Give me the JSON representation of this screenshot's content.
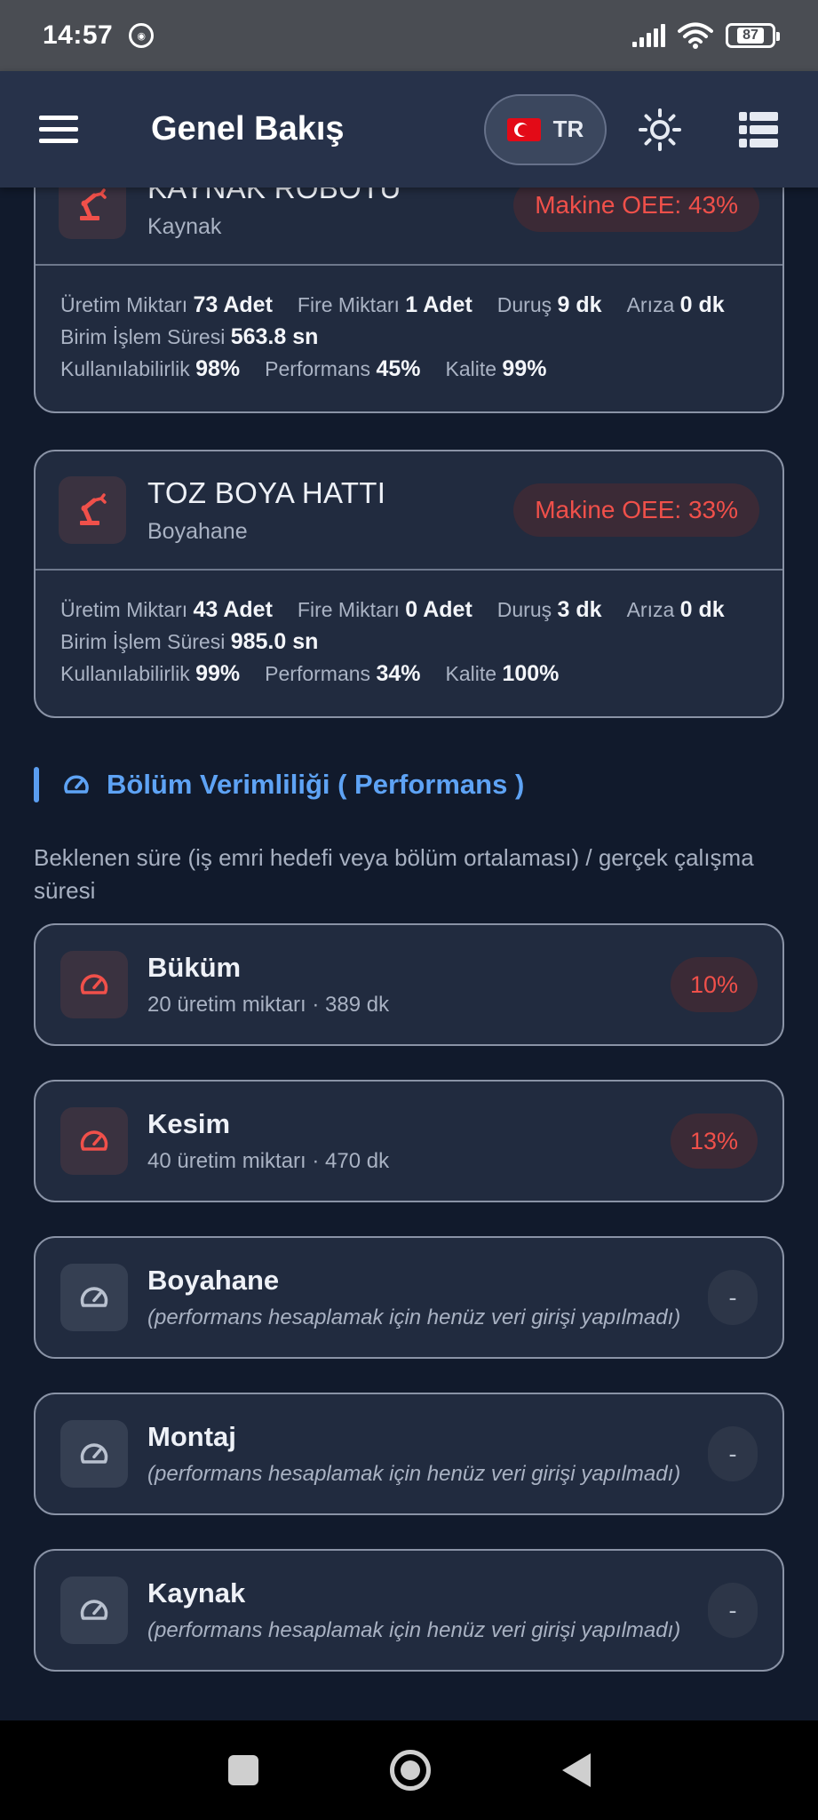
{
  "status_bar": {
    "time": "14:57",
    "battery": "87"
  },
  "header": {
    "title": "Genel Bakış",
    "language": "TR"
  },
  "machines": [
    {
      "name": "KAYNAK ROBOTU",
      "department": "Kaynak",
      "oee": "Makine OEE: 43%",
      "uretim_label": "Üretim Miktarı",
      "uretim": "73 Adet",
      "fire_label": "Fire Miktarı",
      "fire": "1 Adet",
      "durus_label": "Duruş",
      "durus": "9 dk",
      "ariza_label": "Arıza",
      "ariza": "0 dk",
      "sure_label": "Birim İşlem Süresi",
      "sure": "563.8 sn",
      "kull_label": "Kullanılabilirlik",
      "kull": "98%",
      "perf_label": "Performans",
      "perf": "45%",
      "kalite_label": "Kalite",
      "kalite": "99%"
    },
    {
      "name": "TOZ BOYA HATTI",
      "department": "Boyahane",
      "oee": "Makine OEE: 33%",
      "uretim_label": "Üretim Miktarı",
      "uretim": "43 Adet",
      "fire_label": "Fire Miktarı",
      "fire": "0 Adet",
      "durus_label": "Duruş",
      "durus": "3 dk",
      "ariza_label": "Arıza",
      "ariza": "0 dk",
      "sure_label": "Birim İşlem Süresi",
      "sure": "985.0 sn",
      "kull_label": "Kullanılabilirlik",
      "kull": "99%",
      "perf_label": "Performans",
      "perf": "34%",
      "kalite_label": "Kalite",
      "kalite": "100%"
    }
  ],
  "section": {
    "title": "Bölüm Verimliliği ( Performans )",
    "description": "Beklenen süre (iş emri hedefi veya bölüm ortalaması) / gerçek çalışma süresi"
  },
  "departments": [
    {
      "name": "Büküm",
      "sub": "20 üretim miktarı · 389 dk",
      "value": "10%"
    },
    {
      "name": "Kesim",
      "sub": "40 üretim miktarı · 470 dk",
      "value": "13%"
    },
    {
      "name": "Boyahane",
      "sub": "(performans hesaplamak için henüz veri girişi yapılmadı)",
      "value": "-"
    },
    {
      "name": "Montaj",
      "sub": "(performans hesaplamak için henüz veri girişi yapılmadı)",
      "value": "-"
    },
    {
      "name": "Kaynak",
      "sub": "(performans hesaplamak için henüz veri girişi yapılmadı)",
      "value": "-"
    }
  ],
  "colors": {
    "accent": "#5ea3f5",
    "danger": "#f0504a",
    "card": "#212b3f",
    "background": "#111a2c"
  },
  "icons": {
    "machine": "robot-arm-icon",
    "department": "gauge-icon"
  }
}
